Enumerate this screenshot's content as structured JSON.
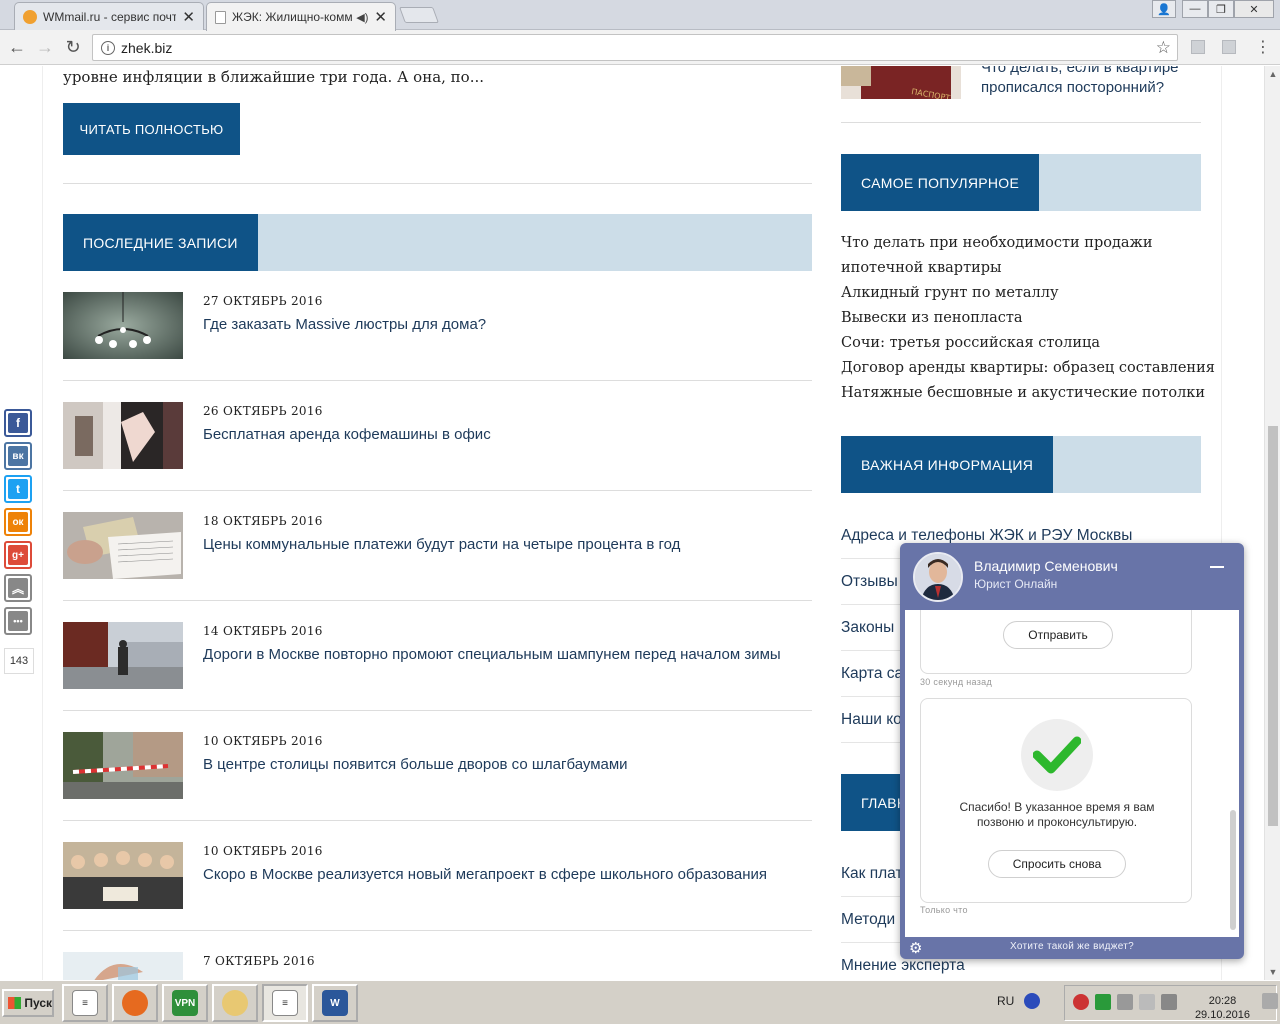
{
  "browser": {
    "tabs": [
      {
        "title": "WMmail.ru - сервис почтов",
        "active": false,
        "audio": false
      },
      {
        "title": "ЖЭК: Жилищно-комму",
        "active": true,
        "audio": true
      }
    ],
    "url": "zhek.biz"
  },
  "main": {
    "excerpt": "уровне инфляции в ближайшие три года. А она, по...",
    "read_more": "ЧИТАТЬ ПОЛНОСТЬЮ",
    "recent_header": "ПОСЛЕДНИЕ ЗАПИСИ",
    "posts": [
      {
        "date": "27 ОКТЯБРЬ 2016",
        "title": "Где заказать Massive люстры для дома?"
      },
      {
        "date": "26 ОКТЯБРЬ 2016",
        "title": "Бесплатная аренда кофемашины в офис"
      },
      {
        "date": "18 ОКТЯБРЬ 2016",
        "title": "Цены коммунальные платежи будут расти на четыре процента в год"
      },
      {
        "date": "14 ОКТЯБРЬ 2016",
        "title": "Дороги в Москве повторно промоют специальным шампунем перед началом зимы"
      },
      {
        "date": "10 ОКТЯБРЬ 2016",
        "title": "В центре столицы появится больше дворов со шлагбаумами"
      },
      {
        "date": "10 ОКТЯБРЬ 2016",
        "title": "Скоро в Москве реализуется новый мегапроект в сфере школьного образования"
      },
      {
        "date": "7 ОКТЯБРЬ 2016",
        "title": ""
      }
    ]
  },
  "sidebar": {
    "top_post_title_line1": "Что делать, если в квартире",
    "top_post_title_line2": "прописался посторонний?",
    "popular_header": "САМОЕ ПОПУЛЯРНОЕ",
    "popular": [
      "Что делать при необходимости продажи",
      "ипотечной квартиры",
      "Алкидный грунт по металлу",
      "Вывески из пенопласта",
      "Сочи: третья российская столица",
      "Договор аренды квартиры: образец составления",
      "Натяжные бесшовные и акустические потолки"
    ],
    "info_header": "ВАЖНАЯ ИНФОРМАЦИЯ",
    "info_links": [
      "Адреса и телефоны ЖЭК и РЭУ Москвы",
      "Отзывы",
      "Законы",
      "Карта са",
      "Наши ко"
    ],
    "main_header": "ГЛАВН",
    "main_links": [
      "Как плат",
      "Методи",
      "Мнение эксперта"
    ]
  },
  "share": {
    "buttons": [
      {
        "name": "facebook",
        "glyph": "f",
        "color": "#3b5998"
      },
      {
        "name": "vk",
        "glyph": "вк",
        "color": "#4c75a3"
      },
      {
        "name": "twitter",
        "glyph": "t",
        "color": "#1da1f2"
      },
      {
        "name": "odnoklassniki",
        "glyph": "ок",
        "color": "#ee8208"
      },
      {
        "name": "googleplus",
        "glyph": "g+",
        "color": "#dd4b39"
      },
      {
        "name": "up",
        "glyph": "︽",
        "color": "#888888"
      },
      {
        "name": "more",
        "glyph": "•••",
        "color": "#888888"
      }
    ],
    "count": "143"
  },
  "chat": {
    "agent_name": "Владимир Семенович",
    "agent_role": "Юрист Онлайн",
    "send_button": "Отправить",
    "ts1": "30 секунд назад",
    "thanks_line1": "Спасибо! В указанное время я вам",
    "thanks_line2": "позвоню и проконсультирую.",
    "ask_again": "Спросить снова",
    "ts2": "Только что",
    "footer_question": "Хотите такой же виджет?"
  },
  "taskbar": {
    "start_label": "Пуск",
    "language": "RU",
    "time": "20:28",
    "date": "29.10.2016"
  },
  "colors": {
    "brand_blue": "#0f5387",
    "header_tint": "#ccdde8",
    "chat_purple": "#6874a8",
    "check_green": "#2db82d"
  }
}
